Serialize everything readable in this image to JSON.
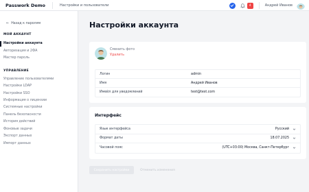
{
  "topbar": {
    "brand": "Passwork Demo",
    "section": "Настройки и пользователи",
    "notification_count": "4",
    "user_name": "Андрей Иванов"
  },
  "sidebar": {
    "back_label": "Назад к паролям",
    "my_account_heading": "МОЙ АККАУНТ",
    "my_account_items": [
      {
        "label": "Настройки аккаунта",
        "active": true
      },
      {
        "label": "Авторизация и 2ФА"
      },
      {
        "label": "Мастер пароль"
      }
    ],
    "management_heading": "УПРАВЛЕНИЕ",
    "management_items": [
      {
        "label": "Управление пользователями"
      },
      {
        "label": "Настройки LDAP"
      },
      {
        "label": "Настройки SSO"
      },
      {
        "label": "Информация о лицензии"
      },
      {
        "label": "Системные настройки"
      },
      {
        "label": "Панель безопасности"
      },
      {
        "label": "История действий"
      },
      {
        "label": "Фоновые задачи"
      },
      {
        "label": "Экспорт данных"
      },
      {
        "label": "Импорт данных"
      }
    ]
  },
  "main": {
    "title": "Настройки аккаунта",
    "photo": {
      "change_label": "Сменить фото",
      "remove_label": "Удалить"
    },
    "info_rows": [
      {
        "label": "Логин",
        "value": "admin"
      },
      {
        "label": "Имя",
        "value": "Андрей Иванов"
      },
      {
        "label": "Имейл для уведомлений",
        "value": "test@test.com"
      }
    ],
    "interface": {
      "title": "Интерфейс",
      "rows": [
        {
          "label": "Язык интерфейса",
          "value": "Русский"
        },
        {
          "label": "Формат даты",
          "value": "18.07.2025"
        },
        {
          "label": "Часовой пояс",
          "value": "(UTC+03:00) Москва, Санкт-Петербург"
        }
      ]
    },
    "save_label": "Сохранить настройки",
    "cancel_label": "Отменить изменения"
  },
  "colors": {
    "accent_blue": "#2563eb",
    "badge_red": "#ef4444",
    "remove_red": "#ef4444",
    "background": "#f3f4f6"
  },
  "icons": [
    "check-circle-icon",
    "bell-icon",
    "chevron-down-icon",
    "arrow-left-icon",
    "avatar"
  ]
}
